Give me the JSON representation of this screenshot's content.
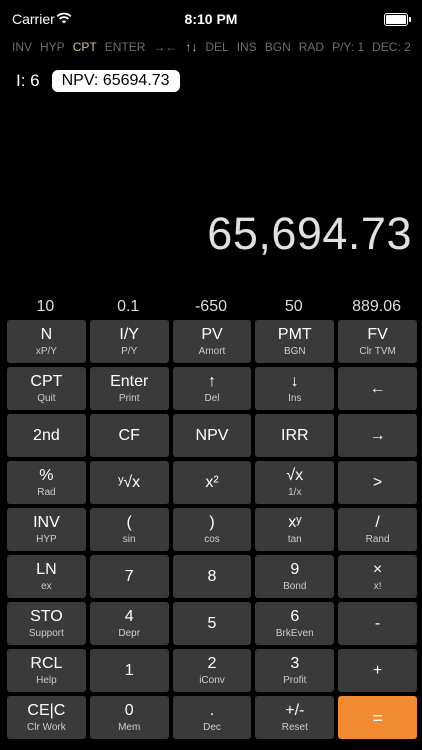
{
  "status": {
    "carrier": "Carrier",
    "time": "8:10 PM"
  },
  "modes": [
    {
      "label": "INV",
      "on": false
    },
    {
      "label": "HYP",
      "on": false
    },
    {
      "label": "CPT",
      "on": true
    },
    {
      "label": "ENTER",
      "on": false
    },
    {
      "label": "→←",
      "on": false
    },
    {
      "label": "↑↓",
      "on": true
    },
    {
      "label": "DEL",
      "on": false
    },
    {
      "label": "INS",
      "on": false
    },
    {
      "label": "BGN",
      "on": false
    },
    {
      "label": "RAD",
      "on": false
    },
    {
      "label": "P/Y: 1",
      "on": false
    },
    {
      "label": "DEC: 2",
      "on": false
    }
  ],
  "indicator": {
    "i_label": "I: 6",
    "npv_label": "NPV: 65694.73"
  },
  "display": {
    "value": "65,694.73"
  },
  "registers": [
    "10",
    "0.1",
    "-650",
    "50",
    "889.06"
  ],
  "keys": [
    [
      {
        "main": "N",
        "sub": "xP/Y"
      },
      {
        "main": "I/Y",
        "sub": "P/Y"
      },
      {
        "main": "PV",
        "sub": "Amort"
      },
      {
        "main": "PMT",
        "sub": "BGN"
      },
      {
        "main": "FV",
        "sub": "Clr TVM"
      }
    ],
    [
      {
        "main": "CPT",
        "sub": "Quit"
      },
      {
        "main": "Enter",
        "sub": "Print"
      },
      {
        "main": "↑",
        "sub": "Del"
      },
      {
        "main": "↓",
        "sub": "Ins"
      },
      {
        "main": "←",
        "sub": ""
      }
    ],
    [
      {
        "main": "2nd",
        "sub": ""
      },
      {
        "main": "CF",
        "sub": ""
      },
      {
        "main": "NPV",
        "sub": ""
      },
      {
        "main": "IRR",
        "sub": ""
      },
      {
        "main": "→",
        "sub": ""
      }
    ],
    [
      {
        "main": "%",
        "sub": "Rad"
      },
      {
        "main": "ʸ√x",
        "sub": ""
      },
      {
        "main": "x²",
        "sub": ""
      },
      {
        "main": "√x",
        "sub": "1/x"
      },
      {
        "main": ">",
        "sub": ""
      }
    ],
    [
      {
        "main": "INV",
        "sub": "HYP"
      },
      {
        "main": "(",
        "sub": "sin"
      },
      {
        "main": ")",
        "sub": "cos"
      },
      {
        "main": "xʸ",
        "sub": "tan"
      },
      {
        "main": "/",
        "sub": "Rand"
      }
    ],
    [
      {
        "main": "LN",
        "sub": "ex"
      },
      {
        "main": "7",
        "sub": ""
      },
      {
        "main": "8",
        "sub": ""
      },
      {
        "main": "9",
        "sub": "Bond"
      },
      {
        "main": "×",
        "sub": "x!"
      }
    ],
    [
      {
        "main": "STO",
        "sub": "Support"
      },
      {
        "main": "4",
        "sub": "Depr"
      },
      {
        "main": "5",
        "sub": ""
      },
      {
        "main": "6",
        "sub": "BrkEven"
      },
      {
        "main": "-",
        "sub": ""
      }
    ],
    [
      {
        "main": "RCL",
        "sub": "Help"
      },
      {
        "main": "1",
        "sub": ""
      },
      {
        "main": "2",
        "sub": "iConv"
      },
      {
        "main": "3",
        "sub": "Profit"
      },
      {
        "main": "+",
        "sub": ""
      }
    ],
    [
      {
        "main": "CE|C",
        "sub": "Clr Work"
      },
      {
        "main": "0",
        "sub": "Mem"
      },
      {
        "main": ".",
        "sub": "Dec"
      },
      {
        "main": "+/-",
        "sub": "Reset"
      },
      {
        "main": "=",
        "sub": ""
      }
    ]
  ]
}
